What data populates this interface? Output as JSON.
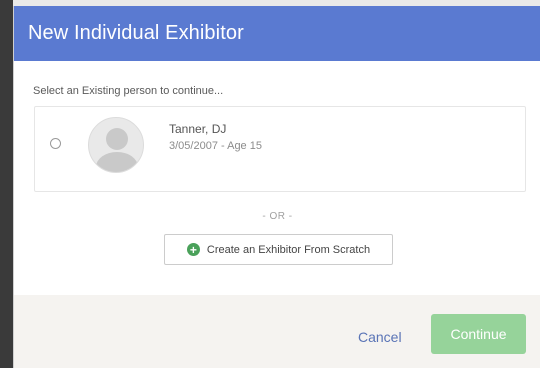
{
  "modal": {
    "title": "New Individual Exhibitor",
    "instruction": "Select an Existing person to continue...",
    "person": {
      "name": "Tanner, DJ",
      "meta": "3/05/2007 - Age 15",
      "avatar_icon": "default-avatar-icon",
      "selected": false
    },
    "or_label": "- OR -",
    "scratch_button": {
      "label": "Create an Exhibitor From Scratch",
      "icon": "plus-circle-icon",
      "icon_color": "#4aa15a"
    },
    "footer": {
      "cancel_label": "Cancel",
      "continue_label": "Continue",
      "continue_color": "#96d39a"
    },
    "header_color": "#5a7ad1"
  }
}
